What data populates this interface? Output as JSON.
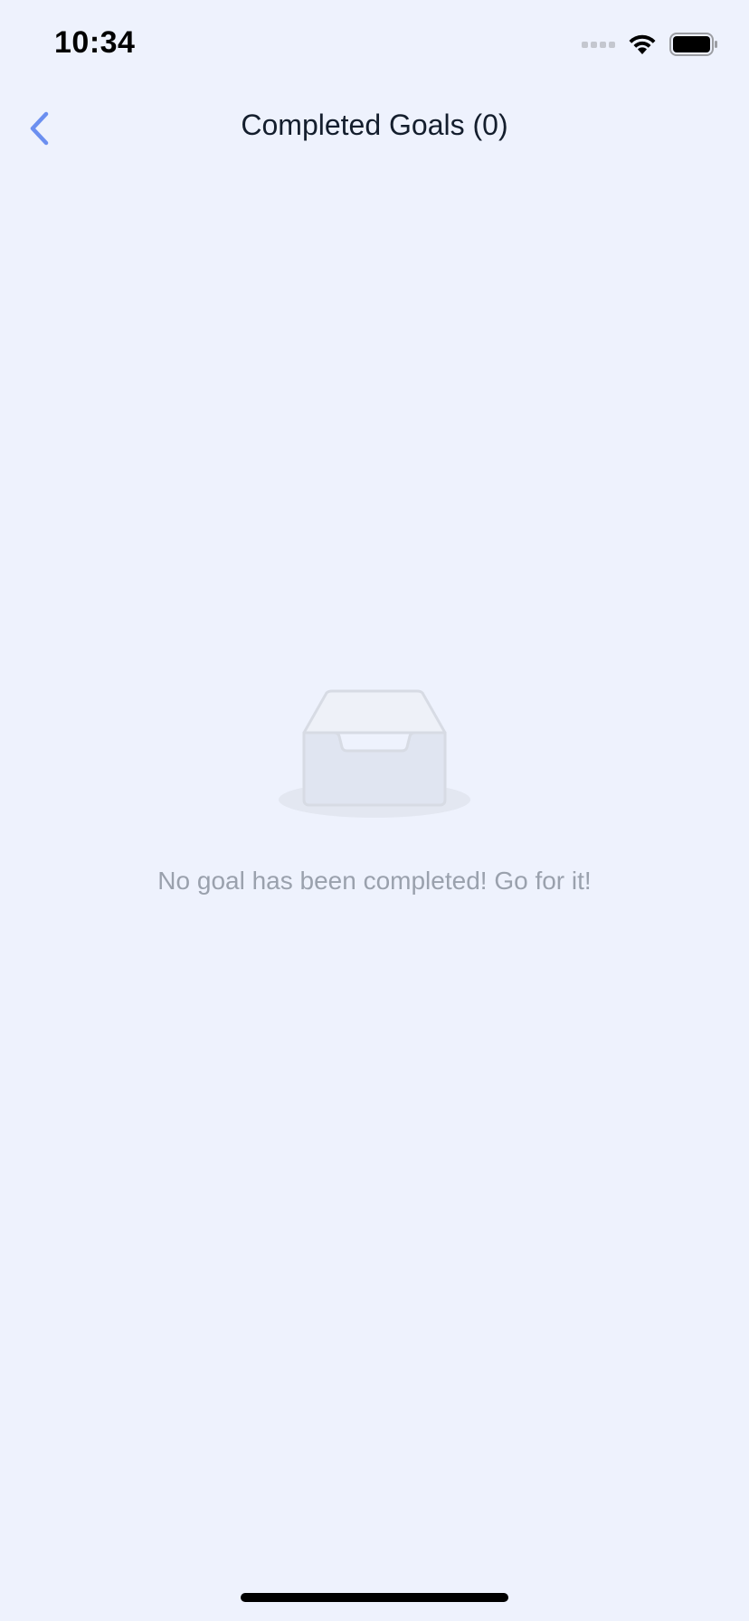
{
  "status_bar": {
    "time": "10:34",
    "icons": [
      "signal-icon",
      "wifi-icon",
      "battery-icon"
    ]
  },
  "nav": {
    "title": "Completed Goals (0)",
    "back_icon": "chevron-left-icon"
  },
  "empty_state": {
    "icon": "empty-inbox-icon",
    "message": "No goal has been completed! Go for it!"
  },
  "colors": {
    "background": "#eef2fd",
    "accent": "#6b8ff0",
    "title": "#141e2d",
    "muted_text": "#9aa1ad"
  }
}
